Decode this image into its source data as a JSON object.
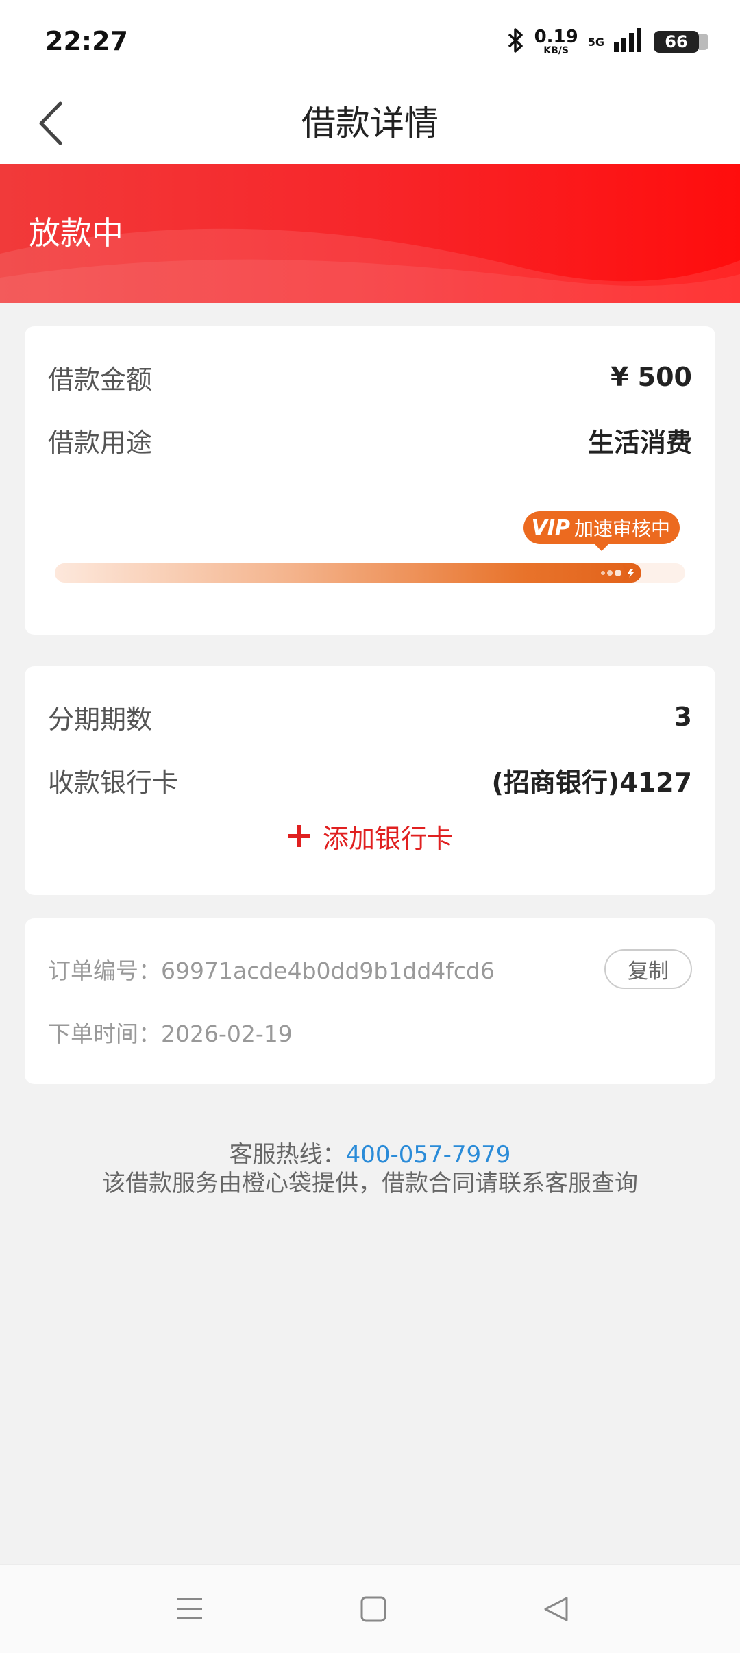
{
  "status_bar": {
    "time": "22:27",
    "net_speed_value": "0.19",
    "net_speed_unit": "KB/S",
    "network_type": "5G",
    "battery": "66",
    "icons": [
      "bluetooth-icon",
      "signal-icon",
      "battery-icon"
    ]
  },
  "header": {
    "title": "借款详情",
    "back_icon": "chevron-left-icon"
  },
  "banner": {
    "status": "放款中",
    "color": "#f7262a"
  },
  "loan": {
    "amount_label": "借款金额",
    "amount_value": "¥ 500",
    "purpose_label": "借款用途",
    "purpose_value": "生活消费",
    "vip_tag": "VIP",
    "progress_label": "加速审核中",
    "progress_fraction": 0.93
  },
  "repayment": {
    "installments_label": "分期期数",
    "installments_value": "3",
    "bank_card_label": "收款银行卡",
    "bank_card_value": "(招商银行)4127",
    "add_card_label": "添加银行卡",
    "add_icon": "plus-icon"
  },
  "order": {
    "order_no_text": "订单编号：69971acde4b0dd9b1dd4fcd6",
    "copy_label": "复制",
    "order_time_text": "下单时间：2026-02-19"
  },
  "footer": {
    "hotline_label": "客服热线：",
    "hotline_number": "400-057-7979",
    "notice": "该借款服务由橙心袋提供，借款合同请联系客服查询"
  },
  "colors": {
    "accent_red": "#e02020",
    "progress_orange": "#e2621a",
    "link_blue": "#2a8bd8"
  }
}
